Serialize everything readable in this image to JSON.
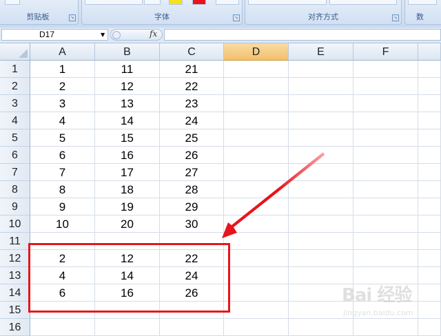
{
  "ribbon": {
    "groups": [
      {
        "label": "剪贴板"
      },
      {
        "label": "字体"
      },
      {
        "label": "对齐方式"
      },
      {
        "label": "数"
      }
    ]
  },
  "formula_bar": {
    "name_box": "D17",
    "fx_label": "fx",
    "formula": ""
  },
  "sheet": {
    "columns": [
      "A",
      "B",
      "C",
      "D",
      "E",
      "F"
    ],
    "active_column": "D",
    "rows": [
      {
        "num": "1",
        "cells": [
          "1",
          "11",
          "21"
        ]
      },
      {
        "num": "2",
        "cells": [
          "2",
          "12",
          "22"
        ]
      },
      {
        "num": "3",
        "cells": [
          "3",
          "13",
          "23"
        ]
      },
      {
        "num": "4",
        "cells": [
          "4",
          "14",
          "24"
        ]
      },
      {
        "num": "5",
        "cells": [
          "5",
          "15",
          "25"
        ]
      },
      {
        "num": "6",
        "cells": [
          "6",
          "16",
          "26"
        ]
      },
      {
        "num": "7",
        "cells": [
          "7",
          "17",
          "27"
        ]
      },
      {
        "num": "8",
        "cells": [
          "8",
          "18",
          "28"
        ]
      },
      {
        "num": "9",
        "cells": [
          "9",
          "19",
          "29"
        ]
      },
      {
        "num": "10",
        "cells": [
          "10",
          "20",
          "30"
        ]
      },
      {
        "num": "11",
        "cells": [
          "",
          "",
          ""
        ]
      },
      {
        "num": "12",
        "cells": [
          "2",
          "12",
          "22"
        ]
      },
      {
        "num": "13",
        "cells": [
          "4",
          "14",
          "24"
        ]
      },
      {
        "num": "14",
        "cells": [
          "6",
          "16",
          "26"
        ]
      },
      {
        "num": "15",
        "cells": [
          "",
          "",
          ""
        ]
      },
      {
        "num": "16",
        "cells": [
          "",
          "",
          ""
        ]
      }
    ]
  },
  "annotation": {
    "color": "#e8141b"
  },
  "watermark": {
    "logo": "Bai 经验",
    "sub": "jingyan.baidu.com"
  }
}
